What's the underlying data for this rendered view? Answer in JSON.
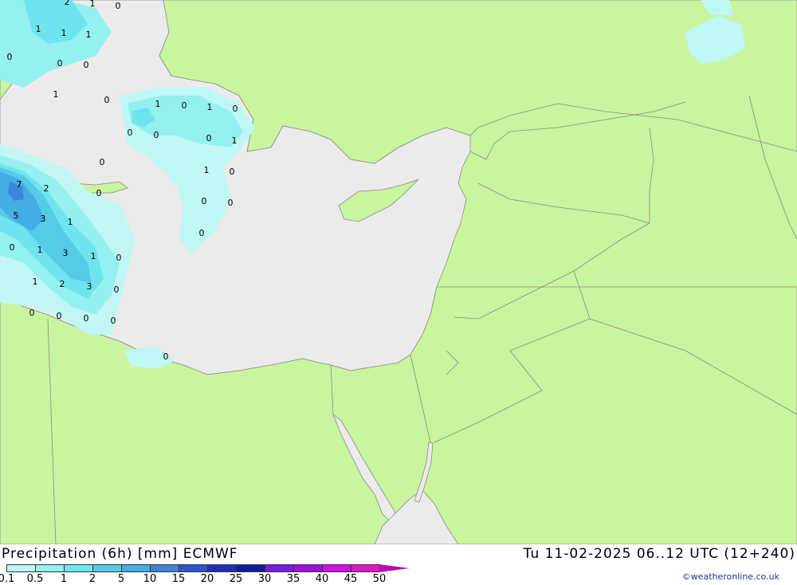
{
  "title_left": "Precipitation (6h) [mm] ECMWF",
  "title_right": "Tu 11-02-2025 06..12 UTC (12+240)",
  "credit": "©weatheronline.co.uk",
  "colors": {
    "land": "#c8f59d",
    "sea": "#ebebeb",
    "border": "#8a8a8a"
  },
  "legend": [
    {
      "label": "0.1",
      "color": "#bff7f5"
    },
    {
      "label": "0.5",
      "color": "#95f0f0"
    },
    {
      "label": "1",
      "color": "#6ee5ee"
    },
    {
      "label": "2",
      "color": "#55cbe8"
    },
    {
      "label": "5",
      "color": "#44ade6"
    },
    {
      "label": "10",
      "color": "#3d85d8"
    },
    {
      "label": "15",
      "color": "#2f55d0"
    },
    {
      "label": "20",
      "color": "#1f2fb8"
    },
    {
      "label": "25",
      "color": "#131a98"
    },
    {
      "label": "30",
      "color": "#7a1be0"
    },
    {
      "label": "35",
      "color": "#a010e0"
    },
    {
      "label": "40",
      "color": "#d010e0"
    },
    {
      "label": "45",
      "color": "#e216c8"
    },
    {
      "label": "50",
      "color": "#b30fb0"
    }
  ],
  "point_values": [
    {
      "v": "2"
    },
    {
      "v": "1"
    },
    {
      "v": "0"
    },
    {
      "v": "1"
    },
    {
      "v": "1"
    },
    {
      "v": "1"
    },
    {
      "v": "0"
    },
    {
      "v": "0"
    },
    {
      "v": "0"
    },
    {
      "v": "1"
    },
    {
      "v": "0"
    },
    {
      "v": "1"
    },
    {
      "v": "0"
    },
    {
      "v": "1"
    },
    {
      "v": "0"
    },
    {
      "v": "0"
    },
    {
      "v": "0"
    },
    {
      "v": "0"
    },
    {
      "v": "1"
    },
    {
      "v": "0"
    },
    {
      "v": "1"
    },
    {
      "v": "0"
    },
    {
      "v": "0"
    },
    {
      "v": "0"
    },
    {
      "v": "7"
    },
    {
      "v": "2"
    },
    {
      "v": "0"
    },
    {
      "v": "5"
    },
    {
      "v": "3"
    },
    {
      "v": "1"
    },
    {
      "v": "0"
    },
    {
      "v": "1"
    },
    {
      "v": "3"
    },
    {
      "v": "1"
    },
    {
      "v": "0"
    },
    {
      "v": "1"
    },
    {
      "v": "2"
    },
    {
      "v": "3"
    },
    {
      "v": "0"
    },
    {
      "v": "0"
    },
    {
      "v": "0"
    },
    {
      "v": "0"
    },
    {
      "v": "0"
    },
    {
      "v": "0"
    },
    {
      "v": "0"
    }
  ]
}
